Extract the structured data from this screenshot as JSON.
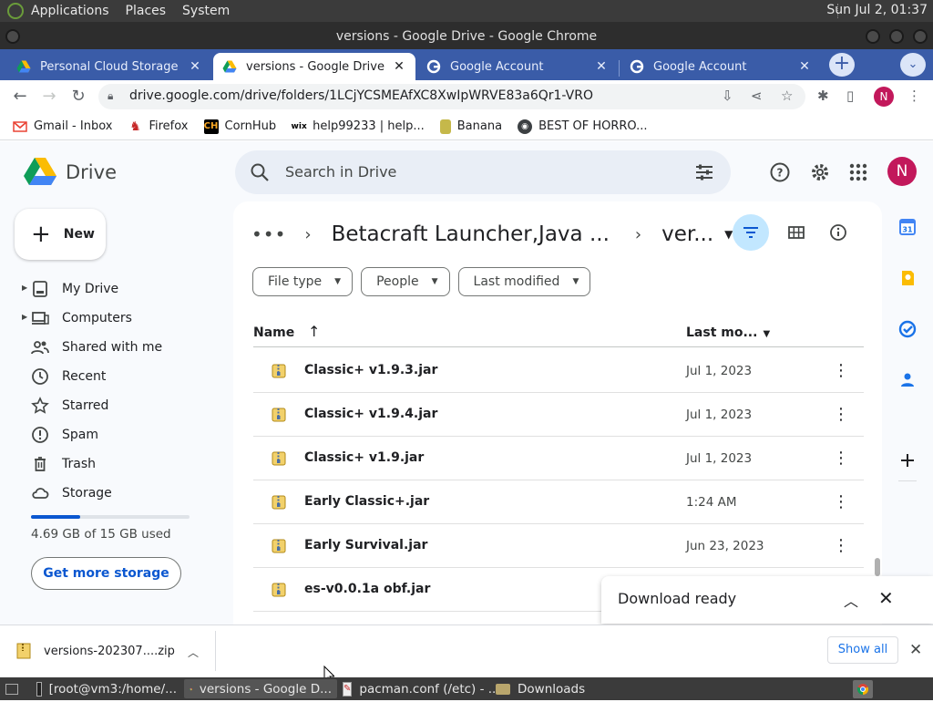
{
  "os_panel": {
    "menus": [
      "Applications",
      "Places",
      "System"
    ],
    "clock": "Sun Jul  2, 01:37"
  },
  "window": {
    "title": "versions - Google Drive - Google Chrome"
  },
  "tabs": [
    {
      "label": "Personal Cloud Storage & F",
      "favicon": "google-drive-icon",
      "active": false
    },
    {
      "label": "versions - Google Drive",
      "favicon": "google-drive-icon",
      "active": true
    },
    {
      "label": "Google Account",
      "favicon": "google-g-icon",
      "active": false
    },
    {
      "label": "Google Account",
      "favicon": "google-g-icon",
      "active": false
    }
  ],
  "address_bar": {
    "url": "drive.google.com/drive/folders/1LCjYCSMEAfXC8XwIpWRVE83a6Qr1-VRO",
    "profile_initial": "N"
  },
  "bookmarks": [
    {
      "label": "Gmail - Inbox",
      "icon": "gmail-icon"
    },
    {
      "label": "Firefox",
      "icon": "firefox-icon"
    },
    {
      "label": "CornHub",
      "icon": "cornhub-icon"
    },
    {
      "label": "help99233 | help...",
      "icon": "wix-icon"
    },
    {
      "label": "Banana",
      "icon": "banana-icon"
    },
    {
      "label": "BEST OF HORRO...",
      "icon": "globe-icon"
    }
  ],
  "drive": {
    "app_name": "Drive",
    "search_placeholder": "Search in Drive",
    "avatar_initial": "N",
    "new_label": "New",
    "nav": [
      {
        "label": "My Drive",
        "icon": "my-drive-icon",
        "expandable": true
      },
      {
        "label": "Computers",
        "icon": "computers-icon",
        "expandable": true
      },
      {
        "label": "Shared with me",
        "icon": "shared-icon",
        "expandable": false
      },
      {
        "label": "Recent",
        "icon": "clock-icon",
        "expandable": false
      },
      {
        "label": "Starred",
        "icon": "star-icon",
        "expandable": false
      },
      {
        "label": "Spam",
        "icon": "spam-icon",
        "expandable": false
      },
      {
        "label": "Trash",
        "icon": "trash-icon",
        "expandable": false
      },
      {
        "label": "Storage",
        "icon": "cloud-icon",
        "expandable": false
      }
    ],
    "storage": {
      "used_text": "4.69 GB of 15 GB used",
      "used_fraction": 0.313,
      "cta": "Get more storage"
    },
    "breadcrumb": {
      "parent": "Betacraft Launcher,Java ...",
      "current": "ver..."
    },
    "filters": [
      "File type",
      "People",
      "Last modified"
    ],
    "columns": {
      "name": "Name",
      "modified": "Last mo..."
    },
    "files": [
      {
        "name": "Classic+ v1.9.3.jar",
        "modified": "Jul 1, 2023"
      },
      {
        "name": "Classic+ v1.9.4.jar",
        "modified": "Jul 1, 2023"
      },
      {
        "name": "Classic+ v1.9.jar",
        "modified": "Jul 1, 2023"
      },
      {
        "name": "Early Classic+.jar",
        "modified": "1:24 AM"
      },
      {
        "name": "Early Survival.jar",
        "modified": "Jun 23, 2023"
      },
      {
        "name": "es-v0.0.1a obf.jar",
        "modified": ""
      }
    ],
    "toast": {
      "message": "Download ready"
    }
  },
  "download_shelf": {
    "filename": "versions-202307....zip",
    "show_all": "Show all"
  },
  "taskbar": [
    {
      "label": "[root@vm3:/home/...",
      "icon": "terminal-icon",
      "active": false
    },
    {
      "label": "versions - Google D...",
      "icon": "chrome-icon",
      "active": true
    },
    {
      "label": "pacman.conf (/etc) - ...",
      "icon": "text-editor-icon",
      "active": false
    },
    {
      "label": "Downloads",
      "icon": "folder-icon",
      "active": false
    }
  ],
  "colors": {
    "tabstrip": "#3a5ca8",
    "drive_blue": "#0b57d0",
    "avatar": "#c2185b",
    "filter_active": "#c2e7ff"
  }
}
